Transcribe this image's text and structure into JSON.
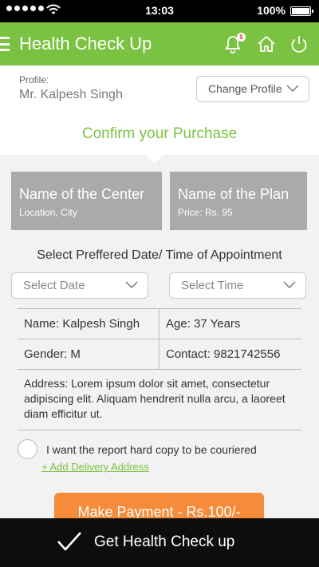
{
  "status_bar": {
    "time": "13:03",
    "battery": "100%",
    "signal_icon": "signal-dots-icon",
    "wifi_icon": "wifi-icon",
    "battery_icon": "battery-icon"
  },
  "header": {
    "title": "Health Check Up",
    "notification_count": "8",
    "icons": [
      "menu-icon",
      "bell-icon",
      "home-icon",
      "power-icon"
    ]
  },
  "profile": {
    "label": "Profile:",
    "name": "Mr. Kalpesh Singh",
    "change_button": "Change Profile"
  },
  "confirm_title": "Confirm your Purchase",
  "center_card": {
    "title": "Name of the Center",
    "subtitle": "Location, City"
  },
  "plan_card": {
    "title": "Name of the Plan",
    "subtitle": "Price: Rs. 95"
  },
  "appointment": {
    "heading": "Select Preffered Date/ Time of Appointment",
    "date_placeholder": "Select Date",
    "time_placeholder": "Select Time"
  },
  "patient": {
    "name": "Name: Kalpesh Singh",
    "age": "Age: 37 Years",
    "gender": "Gender: M",
    "contact": "Contact: 9821742556",
    "address": "Address: Lorem ipsum dolor sit amet, consectetur adipiscing elit. Aliquam hendrerit nulla arcu, a laoreet diam efficitur ut."
  },
  "hard_copy": {
    "label": "I want the report hard copy to be couriered",
    "checked": false,
    "add_address": "+ Add Delivery Address"
  },
  "pay_button": "Make Payment - Rs.100/-",
  "bottom_bar": {
    "label": "Get Health Check up"
  },
  "colors": {
    "brand_green": "#7cc242",
    "accent_orange": "#f68b3a",
    "card_gray": "#aaaaaa",
    "bottom_bar": "#0d0d0d"
  }
}
